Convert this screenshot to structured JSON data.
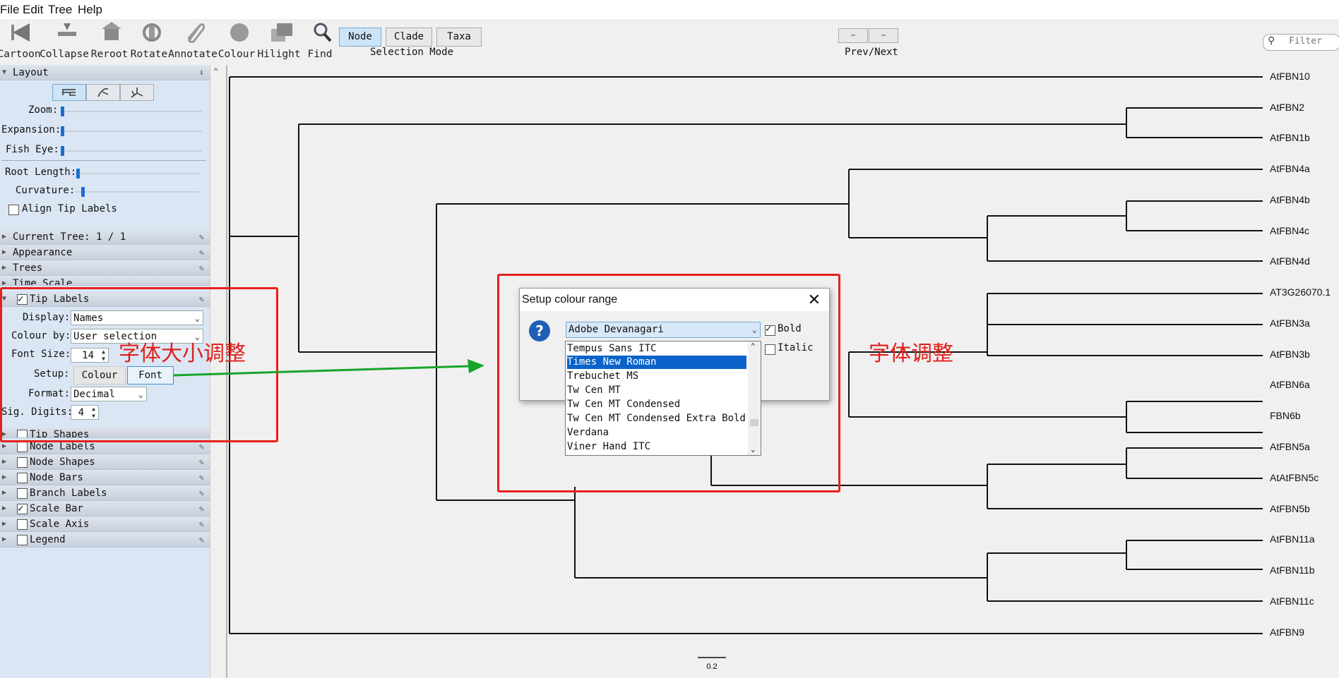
{
  "menu": [
    "File",
    "Edit",
    "Tree",
    "Help"
  ],
  "toolbar": {
    "tools": [
      {
        "label": "Cartoon",
        "icon": "cartoon-icon"
      },
      {
        "label": "Collapse",
        "icon": "collapse-icon"
      },
      {
        "label": "Reroot",
        "icon": "reroot-icon"
      },
      {
        "label": "Rotate",
        "icon": "rotate-icon"
      },
      {
        "label": "Annotate",
        "icon": "annotate-icon"
      },
      {
        "label": "Colour",
        "icon": "colour-icon"
      },
      {
        "label": "Hilight",
        "icon": "hilight-icon"
      },
      {
        "label": "Find",
        "icon": "find-icon"
      }
    ],
    "selection_mode": {
      "buttons": [
        "Node",
        "Clade",
        "Taxa"
      ],
      "selected": "Node",
      "label": "Selection Mode"
    },
    "prev_next_label": "Prev/Next",
    "filter_placeholder": "Filter"
  },
  "panel": {
    "layout": {
      "title": "Layout",
      "zoom_label": "Zoom:",
      "expansion_label": "Expansion:",
      "fisheye_label": "Fish Eye:",
      "root_length_label": "Root Length:",
      "curvature_label": "Curvature:",
      "align_label": "Align Tip Labels",
      "zoom": 0,
      "expansion": 0,
      "fisheye": 0,
      "root_length": 0.01,
      "curvature": 0.05
    },
    "current_tree": "Current Tree: 1 / 1",
    "appearance": "Appearance",
    "trees": "Trees",
    "time_scale": "Time Scale",
    "tip_labels": {
      "title": "Tip Labels",
      "checked": true,
      "display_label": "Display:",
      "display_value": "Names",
      "colour_by_label": "Colour by:",
      "colour_by_value": "User selection",
      "font_size_label": "Font Size:",
      "font_size_value": "14",
      "setup_label": "Setup:",
      "colour_button": "Colour",
      "font_button": "Font",
      "format_label": "Format:",
      "format_value": "Decimal",
      "sig_digits_label": "Sig. Digits:",
      "sig_digits_value": "4"
    },
    "sections_after": [
      {
        "title": "Tip Shapes",
        "checked": false
      },
      {
        "title": "Node Labels",
        "checked": false
      },
      {
        "title": "Node Shapes",
        "checked": false
      },
      {
        "title": "Node Bars",
        "checked": false
      },
      {
        "title": "Branch Labels",
        "checked": false
      },
      {
        "title": "Scale Bar",
        "checked": true
      },
      {
        "title": "Scale Axis",
        "checked": false
      },
      {
        "title": "Legend",
        "checked": false
      }
    ]
  },
  "tree": {
    "tips": [
      "AtFBN10",
      "AtFBN2",
      "AtFBN1b",
      "AtFBN4a",
      "AtFBN4b",
      "AtFBN4c",
      "AtFBN4d",
      "AT3G26070.1",
      "AtFBN3a",
      "AtFBN3b",
      "AtFBN6a",
      "FBN6b",
      "AtFBN5a",
      "AtAtFBN5c",
      "AtFBN5b",
      "AtFBN11a",
      "AtFBN11b",
      "AtFBN11c",
      "AtFBN9"
    ],
    "scale_bar_label": "0.2"
  },
  "dialog": {
    "title": "Setup colour range",
    "selected_font": "Adobe Devanagari",
    "font_options": [
      "Tempus Sans ITC",
      "Times New Roman",
      "Trebuchet MS",
      "Tw Cen MT",
      "Tw Cen MT Condensed",
      "Tw Cen MT Condensed Extra Bold",
      "Verdana",
      "Viner Hand ITC"
    ],
    "highlighted_option": "Times New Roman",
    "bold_label": "Bold",
    "bold": true,
    "italic_label": "Italic",
    "italic": false
  },
  "annotations": {
    "font_size_note": "字体大小调整",
    "font_note": "字体调整",
    "colors": {
      "box": "#e8201c",
      "arrow": "#17a52a"
    }
  }
}
